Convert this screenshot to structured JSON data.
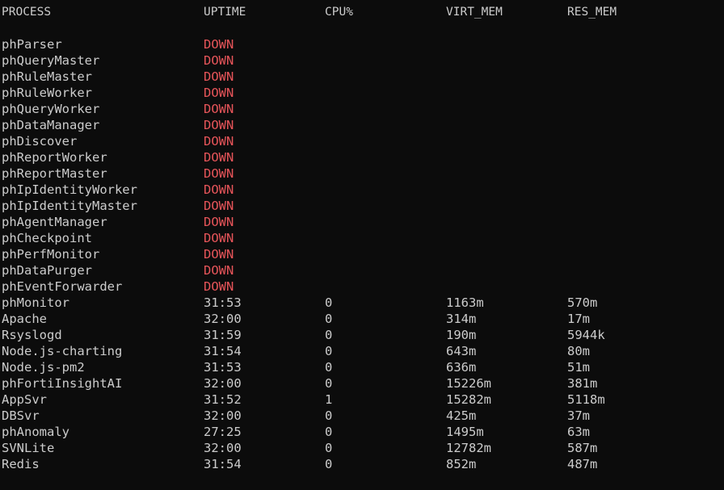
{
  "header": {
    "process": "PROCESS",
    "uptime": "UPTIME",
    "cpu": "CPU%",
    "virt_mem": "VIRT_MEM",
    "res_mem": "RES_MEM"
  },
  "colors": {
    "background": "#0c0c0c",
    "text": "#cccccc",
    "down_status": "#e8555a"
  },
  "processes": [
    {
      "name": "phParser",
      "uptime": "DOWN",
      "cpu": "",
      "virt": "",
      "res": ""
    },
    {
      "name": "phQueryMaster",
      "uptime": "DOWN",
      "cpu": "",
      "virt": "",
      "res": ""
    },
    {
      "name": "phRuleMaster",
      "uptime": "DOWN",
      "cpu": "",
      "virt": "",
      "res": ""
    },
    {
      "name": "phRuleWorker",
      "uptime": "DOWN",
      "cpu": "",
      "virt": "",
      "res": ""
    },
    {
      "name": "phQueryWorker",
      "uptime": "DOWN",
      "cpu": "",
      "virt": "",
      "res": ""
    },
    {
      "name": "phDataManager",
      "uptime": "DOWN",
      "cpu": "",
      "virt": "",
      "res": ""
    },
    {
      "name": "phDiscover",
      "uptime": "DOWN",
      "cpu": "",
      "virt": "",
      "res": ""
    },
    {
      "name": "phReportWorker",
      "uptime": "DOWN",
      "cpu": "",
      "virt": "",
      "res": ""
    },
    {
      "name": "phReportMaster",
      "uptime": "DOWN",
      "cpu": "",
      "virt": "",
      "res": ""
    },
    {
      "name": "phIpIdentityWorker",
      "uptime": "DOWN",
      "cpu": "",
      "virt": "",
      "res": ""
    },
    {
      "name": "phIpIdentityMaster",
      "uptime": "DOWN",
      "cpu": "",
      "virt": "",
      "res": ""
    },
    {
      "name": "phAgentManager",
      "uptime": "DOWN",
      "cpu": "",
      "virt": "",
      "res": ""
    },
    {
      "name": "phCheckpoint",
      "uptime": "DOWN",
      "cpu": "",
      "virt": "",
      "res": ""
    },
    {
      "name": "phPerfMonitor",
      "uptime": "DOWN",
      "cpu": "",
      "virt": "",
      "res": ""
    },
    {
      "name": "phDataPurger",
      "uptime": "DOWN",
      "cpu": "",
      "virt": "",
      "res": ""
    },
    {
      "name": "phEventForwarder",
      "uptime": "DOWN",
      "cpu": "",
      "virt": "",
      "res": ""
    },
    {
      "name": "phMonitor",
      "uptime": "31:53",
      "cpu": "0",
      "virt": "1163m",
      "res": "570m"
    },
    {
      "name": "Apache",
      "uptime": "32:00",
      "cpu": "0",
      "virt": "314m",
      "res": "17m"
    },
    {
      "name": "Rsyslogd",
      "uptime": "31:59",
      "cpu": "0",
      "virt": "190m",
      "res": "5944k"
    },
    {
      "name": "Node.js-charting",
      "uptime": "31:54",
      "cpu": "0",
      "virt": "643m",
      "res": "80m"
    },
    {
      "name": "Node.js-pm2",
      "uptime": "31:53",
      "cpu": "0",
      "virt": "636m",
      "res": "51m"
    },
    {
      "name": "phFortiInsightAI",
      "uptime": "32:00",
      "cpu": "0",
      "virt": "15226m",
      "res": "381m"
    },
    {
      "name": "AppSvr",
      "uptime": "31:52",
      "cpu": "1",
      "virt": "15282m",
      "res": "5118m"
    },
    {
      "name": "DBSvr",
      "uptime": "32:00",
      "cpu": "0",
      "virt": "425m",
      "res": "37m"
    },
    {
      "name": "phAnomaly",
      "uptime": "27:25",
      "cpu": "0",
      "virt": "1495m",
      "res": "63m"
    },
    {
      "name": "SVNLite",
      "uptime": "32:00",
      "cpu": "0",
      "virt": "12782m",
      "res": "587m"
    },
    {
      "name": "Redis",
      "uptime": "31:54",
      "cpu": "0",
      "virt": "852m",
      "res": "487m"
    }
  ]
}
